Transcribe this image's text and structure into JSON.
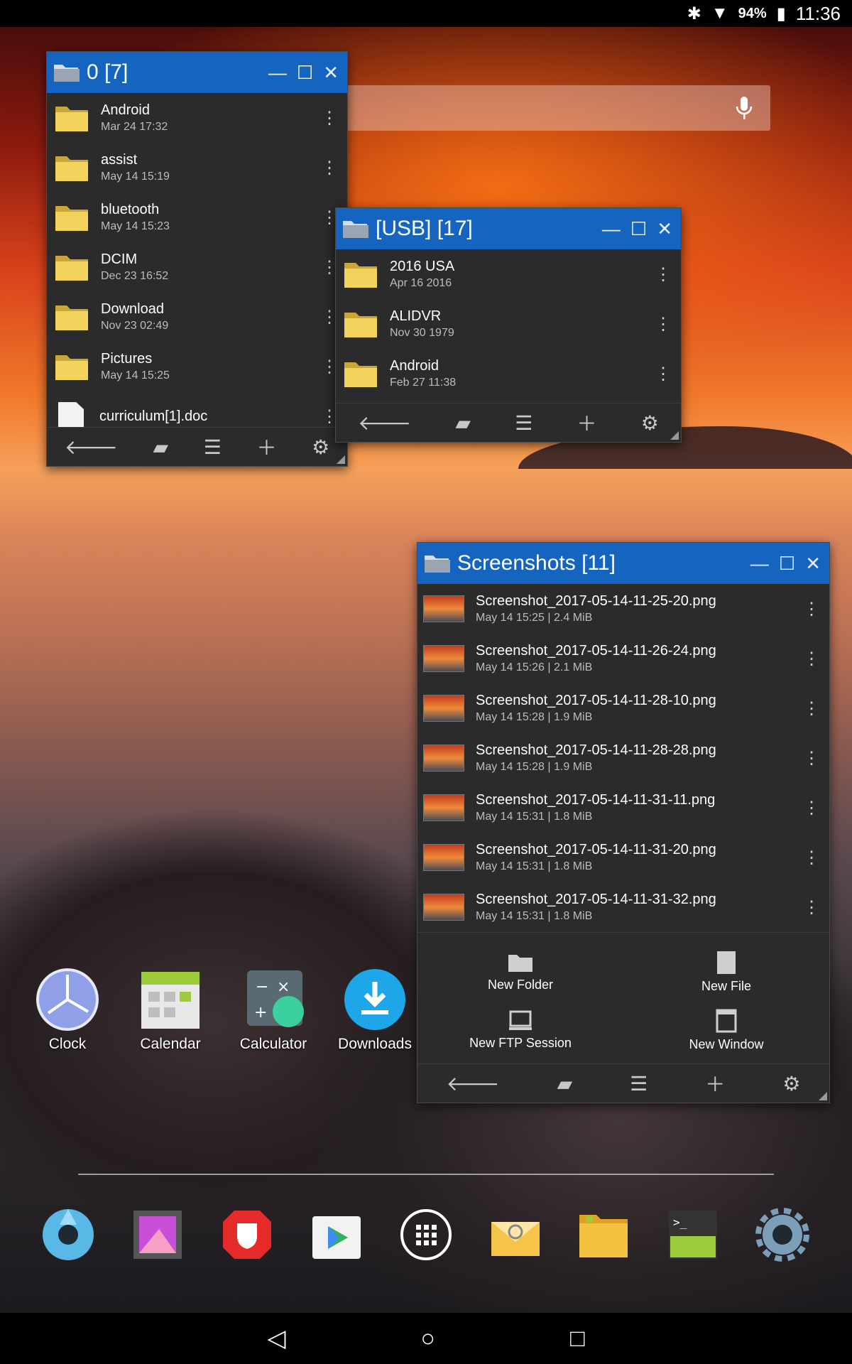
{
  "status_bar": {
    "battery": "94%",
    "time": "11:36",
    "icons": [
      "bluetooth-icon",
      "wifi-icon",
      "battery-icon"
    ]
  },
  "windows": [
    {
      "title": "0 [7]",
      "items": [
        {
          "name": "Android",
          "meta": "Mar 24 17:32",
          "kind": "folder"
        },
        {
          "name": "assist",
          "meta": "May 14 15:19",
          "kind": "folder"
        },
        {
          "name": "bluetooth",
          "meta": "May 14 15:23",
          "kind": "folder"
        },
        {
          "name": "DCIM",
          "meta": "Dec 23 16:52",
          "kind": "folder"
        },
        {
          "name": "Download",
          "meta": "Nov 23 02:49",
          "kind": "folder"
        },
        {
          "name": "Pictures",
          "meta": "May 14 15:25",
          "kind": "folder"
        },
        {
          "name": "curriculum[1].doc",
          "meta": "",
          "kind": "file"
        }
      ]
    },
    {
      "title": "[USB] [17]",
      "items": [
        {
          "name": "2016 USA",
          "meta": "Apr 16 2016",
          "kind": "folder"
        },
        {
          "name": "ALIDVR",
          "meta": "Nov 30 1979",
          "kind": "folder"
        },
        {
          "name": "Android",
          "meta": "Feb 27 11:38",
          "kind": "folder"
        }
      ]
    },
    {
      "title": "Screenshots [11]",
      "items": [
        {
          "name": "Screenshot_2017-05-14-11-25-20.png",
          "meta": "May 14 15:25  |  2.4 MiB",
          "kind": "image"
        },
        {
          "name": "Screenshot_2017-05-14-11-26-24.png",
          "meta": "May 14 15:26  |  2.1 MiB",
          "kind": "image"
        },
        {
          "name": "Screenshot_2017-05-14-11-28-10.png",
          "meta": "May 14 15:28  |  1.9 MiB",
          "kind": "image"
        },
        {
          "name": "Screenshot_2017-05-14-11-28-28.png",
          "meta": "May 14 15:28  |  1.9 MiB",
          "kind": "image"
        },
        {
          "name": "Screenshot_2017-05-14-11-31-11.png",
          "meta": "May 14 15:31  |  1.8 MiB",
          "kind": "image"
        },
        {
          "name": "Screenshot_2017-05-14-11-31-20.png",
          "meta": "May 14 15:31  |  1.8 MiB",
          "kind": "image"
        },
        {
          "name": "Screenshot_2017-05-14-11-31-32.png",
          "meta": "May 14 15:31  |  1.8 MiB",
          "kind": "image"
        }
      ],
      "actions": [
        "New Folder",
        "New File",
        "New FTP Session",
        "New Window"
      ]
    }
  ],
  "desktop_icons": [
    "Clock",
    "Calendar",
    "Calculator",
    "Downloads"
  ],
  "dock_icons": [
    "camera-icon",
    "gallery-icon",
    "security-icon",
    "play-store-icon",
    "app-drawer-icon",
    "email-icon",
    "file-manager-icon",
    "terminal-icon",
    "settings-icon"
  ],
  "colors": {
    "titlebar": "#1565c0",
    "window_body": "#2b2b2b",
    "folder": "#f2c94c"
  }
}
